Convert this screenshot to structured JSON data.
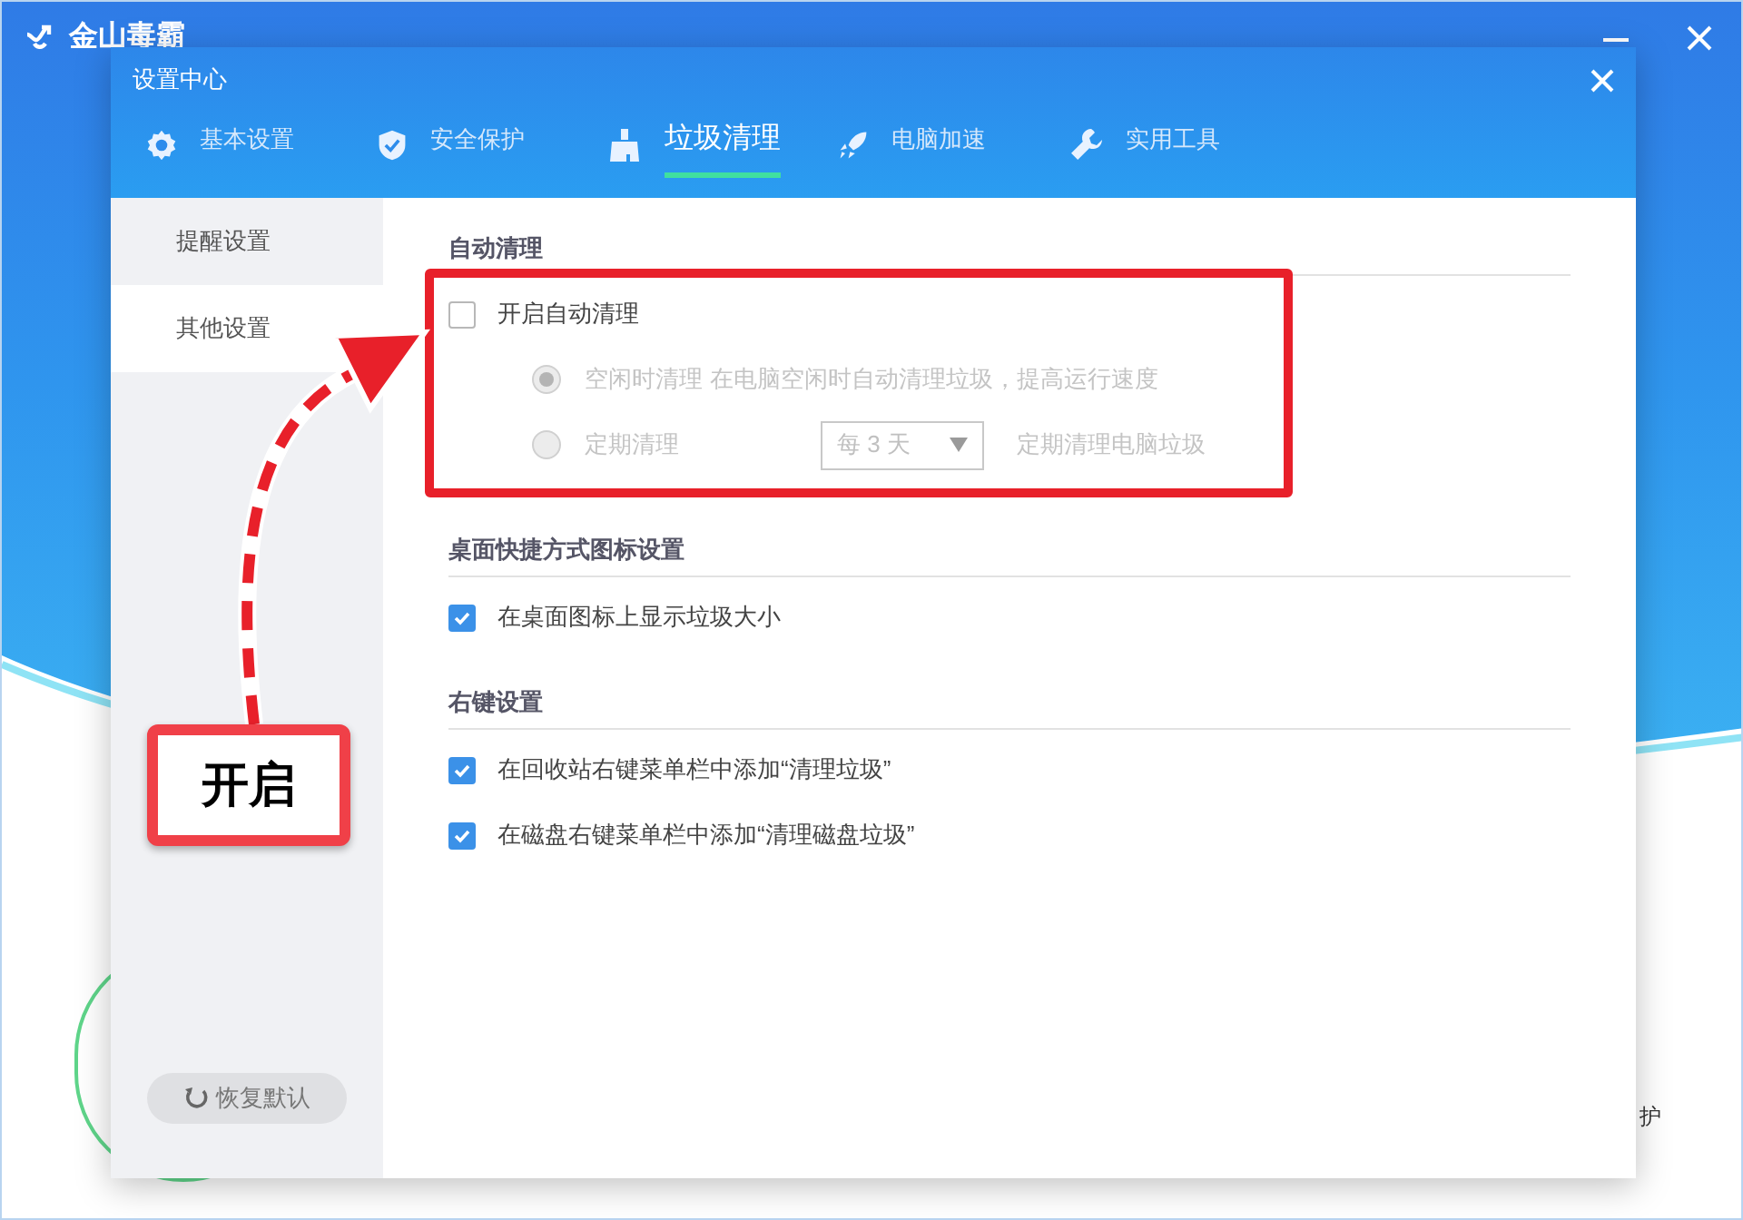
{
  "app": {
    "title": "金山毒霸",
    "partial_text": "护"
  },
  "dialog": {
    "title": "设置中心",
    "tabs": [
      {
        "label": "基本设置",
        "selected": false
      },
      {
        "label": "安全保护",
        "selected": false
      },
      {
        "label": "垃圾清理",
        "selected": true
      },
      {
        "label": "电脑加速",
        "selected": false
      },
      {
        "label": "实用工具",
        "selected": false
      }
    ],
    "sidebar": {
      "items": [
        {
          "label": "提醒设置",
          "selected": false
        },
        {
          "label": "其他设置",
          "selected": true
        }
      ],
      "reset_button": "恢复默认"
    },
    "sections": [
      {
        "title": "自动清理",
        "highlighted": true,
        "items": [
          {
            "kind": "checkbox",
            "label": "开启自动清理",
            "checked": false,
            "disabled": false
          },
          {
            "kind": "radio",
            "label": "空闲时清理",
            "description": "在电脑空闲时自动清理垃圾，提高运行速度",
            "selected": true,
            "disabled": true
          },
          {
            "kind": "radio",
            "label": "定期清理",
            "selected": false,
            "disabled": true,
            "dropdown": "每 3 天",
            "description": "定期清理电脑垃圾"
          }
        ]
      },
      {
        "title": "桌面快捷方式图标设置",
        "highlighted": false,
        "items": [
          {
            "kind": "checkbox",
            "label": "在桌面图标上显示垃圾大小",
            "checked": true,
            "disabled": false
          }
        ]
      },
      {
        "title": "右键设置",
        "highlighted": false,
        "items": [
          {
            "kind": "checkbox",
            "label": "在回收站右键菜单栏中添加“清理垃圾”",
            "checked": true,
            "disabled": false
          },
          {
            "kind": "checkbox",
            "label": "在磁盘右键菜单栏中添加“清理磁盘垃圾”",
            "checked": true,
            "disabled": false
          }
        ]
      }
    ]
  },
  "annotation": {
    "label": "开启"
  }
}
